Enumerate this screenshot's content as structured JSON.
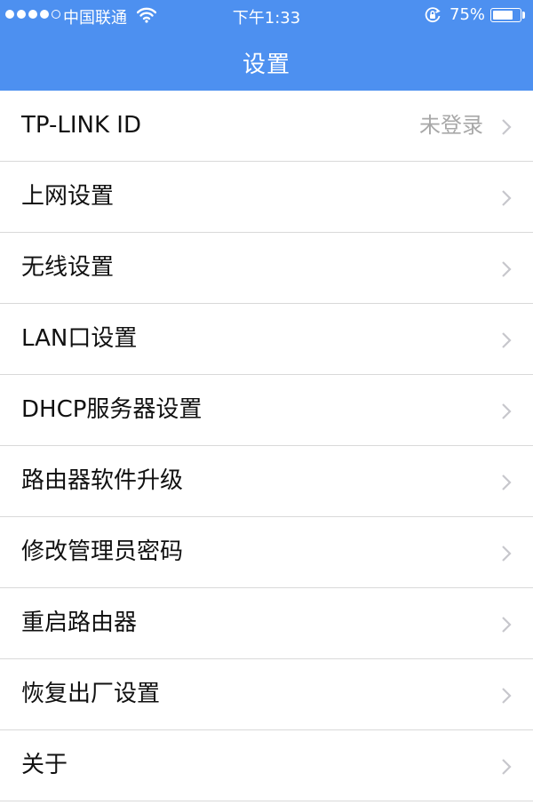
{
  "status_bar": {
    "carrier": "中国联通",
    "time": "下午1:33",
    "battery_percent": "75%",
    "battery_level": 0.75,
    "signal_bars": 4,
    "signal_total": 5,
    "icons": [
      "wifi-icon",
      "rotation-lock-icon",
      "battery-icon"
    ]
  },
  "nav": {
    "title": "设置"
  },
  "colors": {
    "header": "#4d90f0",
    "separator": "#d9d9d9",
    "secondary_text": "#a8a8a8",
    "chevron": "#c7c7cc"
  },
  "menu": [
    {
      "label": "TP-LINK ID",
      "value": "未登录"
    },
    {
      "label": "上网设置"
    },
    {
      "label": "无线设置"
    },
    {
      "label": "LAN口设置"
    },
    {
      "label": "DHCP服务器设置"
    },
    {
      "label": "路由器软件升级"
    },
    {
      "label": "修改管理员密码"
    },
    {
      "label": "重启路由器"
    },
    {
      "label": "恢复出厂设置"
    },
    {
      "label": "关于"
    }
  ]
}
